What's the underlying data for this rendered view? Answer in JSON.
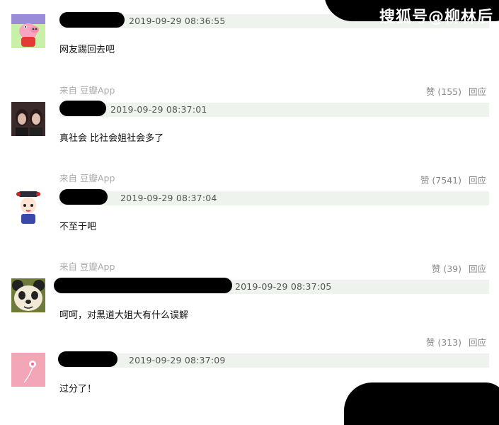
{
  "watermark": "搜狐号@柳林后",
  "comments": [
    {
      "timestamp": "2019-09-29 08:36:55",
      "text": "网友踢回去吧",
      "source": "来自 豆瓣App",
      "likes": "赞 (155)",
      "reply": "回应"
    },
    {
      "timestamp": "2019-09-29 08:37:01",
      "text": "真社会 比社会姐社会多了",
      "source": "来自 豆瓣App",
      "likes": "赞 (7541)",
      "reply": "回应"
    },
    {
      "timestamp": "2019-09-29 08:37:04",
      "text": "不至于吧",
      "source": "来自 豆瓣App",
      "likes": "赞 (39)",
      "reply": "回应"
    },
    {
      "timestamp": "2019-09-29 08:37:05",
      "text": "呵呵，对黑道大姐大有什么误解",
      "source": "",
      "likes": "赞 (313)",
      "reply": "回应"
    },
    {
      "timestamp": "2019-09-29 08:37:09",
      "text": "过分了！",
      "source": "",
      "likes": "",
      "reply": ""
    }
  ],
  "colors": {
    "header_bar": "#eef3ee",
    "timestamp": "#555555",
    "source": "#aaaaaa",
    "actions": "#888888"
  }
}
